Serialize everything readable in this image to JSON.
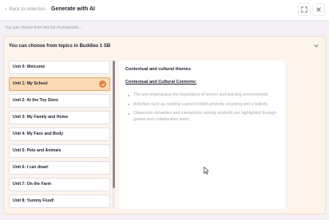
{
  "topbar": {
    "back_label": "Back to selection",
    "title": "Generate with AI",
    "expand_icon": "expand-icon",
    "close_icon": "close-icon"
  },
  "hint": "You can choose from this list of proposals...",
  "panel": {
    "header": "You can choose from topics in Buddies 1 SB",
    "units": [
      {
        "label": "Unit 0: Welcome",
        "selected": false
      },
      {
        "label": "Unit 1: My School",
        "selected": true
      },
      {
        "label": "Unit 2: At the Toy Store",
        "selected": false
      },
      {
        "label": "Unit 3: My Family and Home",
        "selected": false
      },
      {
        "label": "Unit 4: My Face and Body",
        "selected": false
      },
      {
        "label": "Unit 5: Pets and Animals",
        "selected": false
      },
      {
        "label": "Unit 6: I can draw!",
        "selected": false
      },
      {
        "label": "Unit 7: On the Farm",
        "selected": false
      },
      {
        "label": "Unit 8: Yummy Food!",
        "selected": false
      }
    ],
    "content": {
      "title": "Contextual and cultural themes",
      "subtitle": "Contextual and Cultural Contents:",
      "bullets": [
        "The unit emphasizes the importance of school and learning environments.",
        "Activities such as reading a pencil holder promote recycling and creativity.",
        "Classroom dynamics and interactions among students are highlighted through games and collaborative tasks."
      ]
    }
  },
  "colors": {
    "accent": "#e4803a",
    "selected_bg": "#fbd9b4",
    "panel_bg": "#fdf4ec"
  }
}
